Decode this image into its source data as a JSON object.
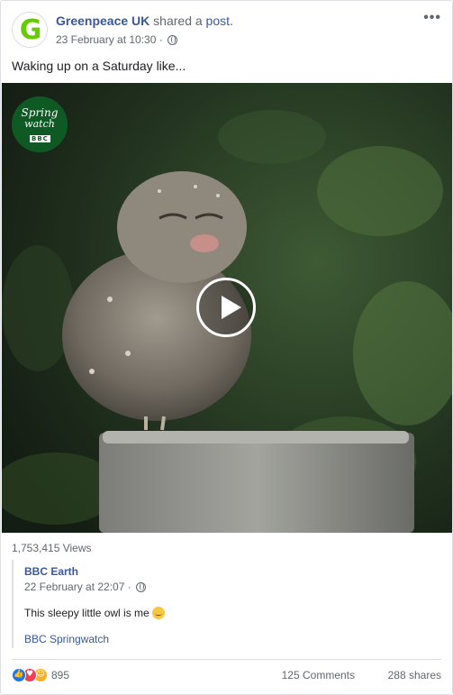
{
  "header": {
    "page_name": "Greenpeace UK",
    "shared_text": " shared a ",
    "post_link": "post.",
    "timestamp": "23 February at 10:30 · ",
    "avatar_letter": "G",
    "more_label": "•••"
  },
  "post": {
    "text": "Waking up on a Saturday like..."
  },
  "video": {
    "badge_line1": "Spring",
    "badge_line2": "watch",
    "badge_bbc": "BBC",
    "views": "1,753,415 Views"
  },
  "shared_post": {
    "page_name": "BBC Earth",
    "timestamp": "22 February at 22:07 · ",
    "text": "This sleepy little owl is me",
    "page_link": "BBC Springwatch"
  },
  "footer": {
    "reaction_count": "895",
    "comments": "125 Comments",
    "shares": "288 shares"
  },
  "colors": {
    "link": "#385898",
    "muted": "#606770",
    "like": "#1877f2",
    "love": "#f33e58",
    "haha": "#f7b125",
    "brand_green": "#66cc00"
  },
  "icons": [
    "globe-icon",
    "play-icon",
    "like-reaction-icon",
    "love-reaction-icon",
    "haha-reaction-icon",
    "more-icon",
    "sleepy-emoji-icon"
  ]
}
